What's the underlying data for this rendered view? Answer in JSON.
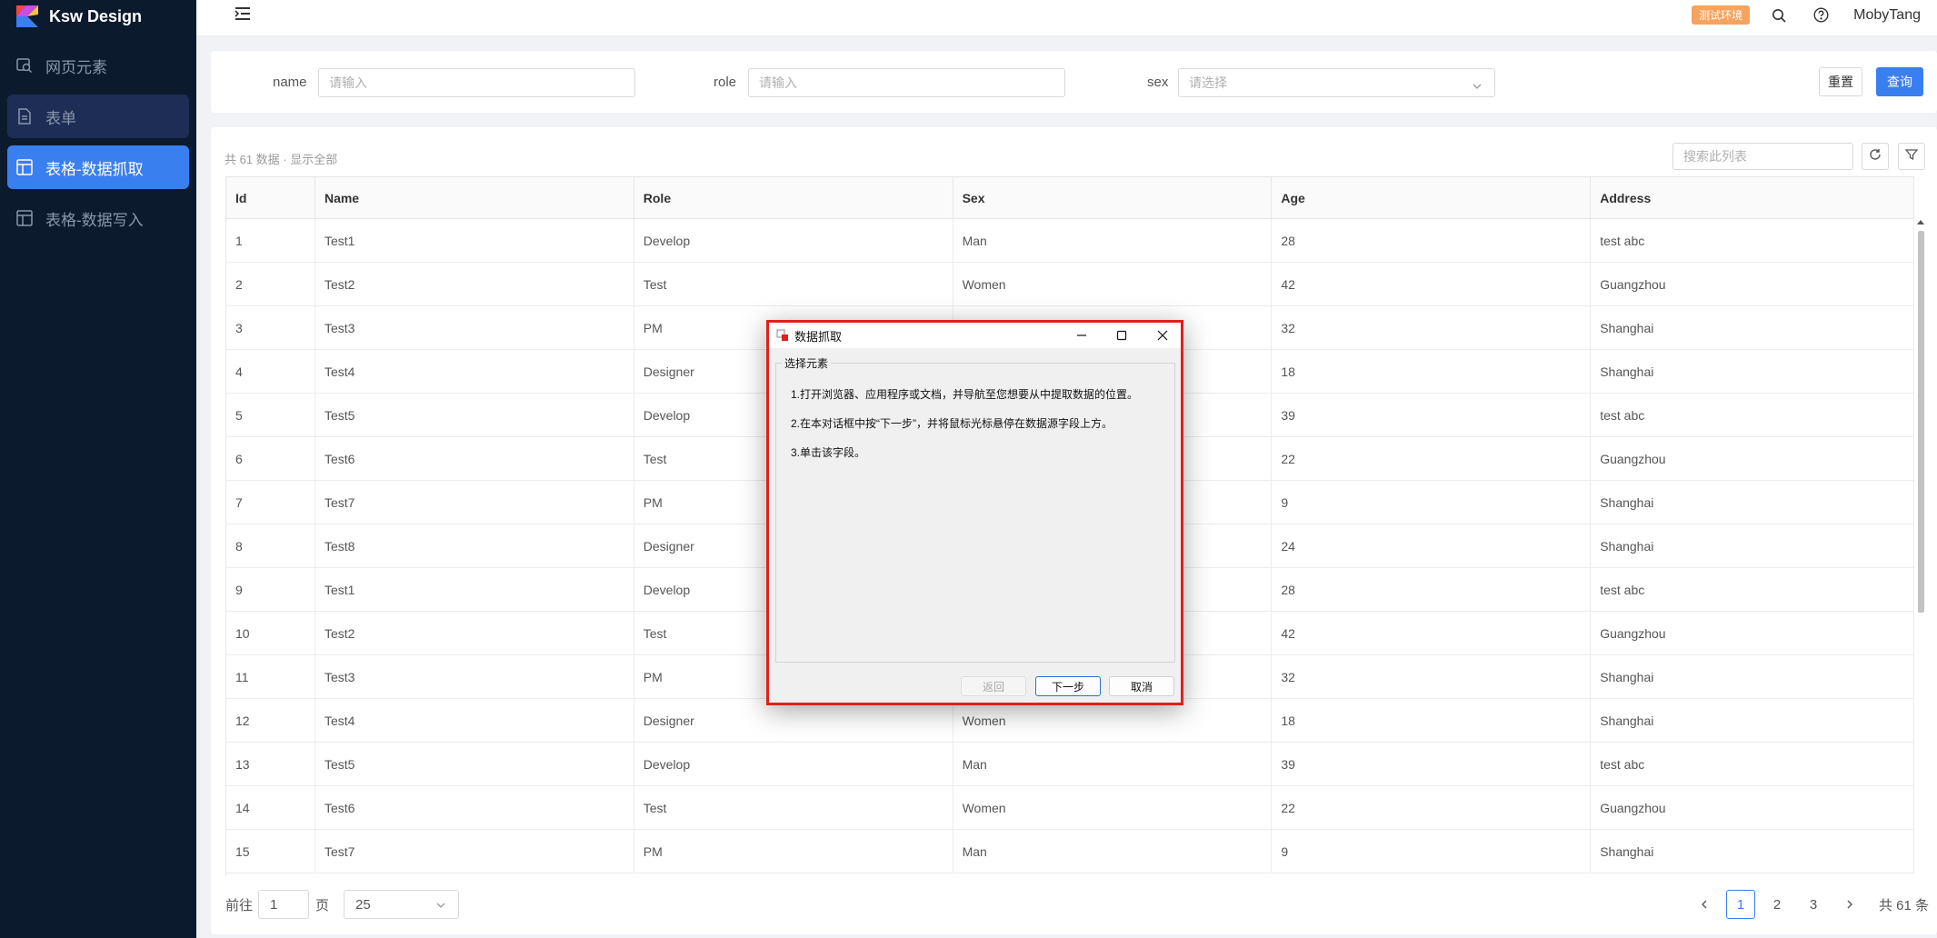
{
  "app": {
    "title": "Ksw Design",
    "brand_colors": [
      "#f5483c",
      "#f7c23b",
      "#3a7fef",
      "#c84de0"
    ]
  },
  "sidebar": {
    "items": [
      {
        "label": "网页元素",
        "icon": "search-page-icon"
      },
      {
        "label": "表单",
        "icon": "document-icon"
      },
      {
        "label": "表格-数据抓取",
        "icon": "table-icon"
      },
      {
        "label": "表格-数据写入",
        "icon": "table-icon"
      }
    ],
    "active_index": 2
  },
  "header": {
    "env_badge": "测试环境",
    "username": "MobyTang",
    "env_color": "#f6a35f"
  },
  "filters": {
    "name_label": "name",
    "name_placeholder": "请输入",
    "role_label": "role",
    "role_placeholder": "请输入",
    "sex_label": "sex",
    "sex_placeholder": "请选择",
    "reset_label": "重置",
    "query_label": "查询"
  },
  "table": {
    "count_text": "共 61 数据 · 显示全部",
    "search_placeholder": "搜索此列表",
    "columns": [
      "Id",
      "Name",
      "Role",
      "Sex",
      "Age",
      "Address"
    ],
    "rows": [
      [
        "1",
        "Test1",
        "Develop",
        "Man",
        "28",
        "test abc"
      ],
      [
        "2",
        "Test2",
        "Test",
        "Women",
        "42",
        "Guangzhou"
      ],
      [
        "3",
        "Test3",
        "PM",
        "",
        "32",
        "Shanghai"
      ],
      [
        "4",
        "Test4",
        "Designer",
        "",
        "18",
        "Shanghai"
      ],
      [
        "5",
        "Test5",
        "Develop",
        "",
        "39",
        "test abc"
      ],
      [
        "6",
        "Test6",
        "Test",
        "",
        "22",
        "Guangzhou"
      ],
      [
        "7",
        "Test7",
        "PM",
        "",
        "9",
        "Shanghai"
      ],
      [
        "8",
        "Test8",
        "Designer",
        "",
        "24",
        "Shanghai"
      ],
      [
        "9",
        "Test1",
        "Develop",
        "",
        "28",
        "test abc"
      ],
      [
        "10",
        "Test2",
        "Test",
        "",
        "42",
        "Guangzhou"
      ],
      [
        "11",
        "Test3",
        "PM",
        "",
        "32",
        "Shanghai"
      ],
      [
        "12",
        "Test4",
        "Designer",
        "Women",
        "18",
        "Shanghai"
      ],
      [
        "13",
        "Test5",
        "Develop",
        "Man",
        "39",
        "test abc"
      ],
      [
        "14",
        "Test6",
        "Test",
        "Women",
        "22",
        "Guangzhou"
      ],
      [
        "15",
        "Test7",
        "PM",
        "Man",
        "9",
        "Shanghai"
      ]
    ]
  },
  "footer": {
    "goto_label": "前往",
    "goto_value": "1",
    "page_label": "页",
    "page_size": "25",
    "pages": [
      "1",
      "2",
      "3"
    ],
    "current_page": "1",
    "total_text": "共 61 条"
  },
  "dialog": {
    "title": "数据抓取",
    "group_label": "选择元素",
    "steps": [
      "1.打开浏览器、应用程序或文档，并导航至您想要从中提取数据的位置。",
      "2.在本对话框中按“下一步”，并将鼠标光标悬停在数据源字段上方。",
      "3.单击该字段。"
    ],
    "back_label": "返回",
    "next_label": "下一步",
    "cancel_label": "取消",
    "highlight_color": "#e0201c"
  }
}
